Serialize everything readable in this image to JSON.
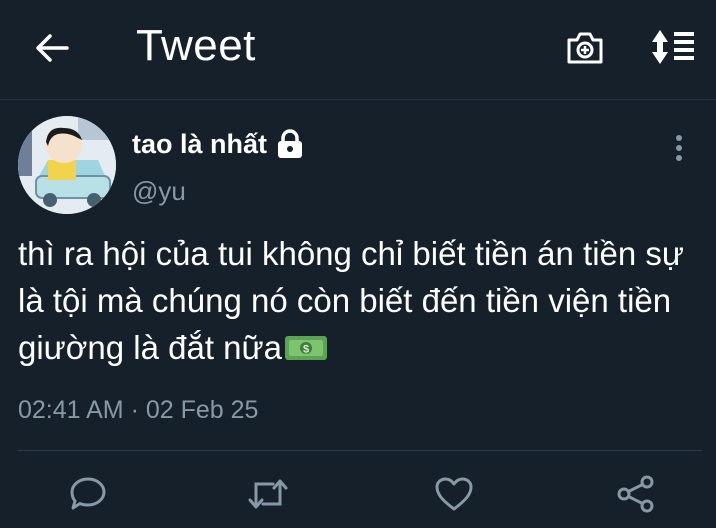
{
  "header": {
    "title": "Tweet",
    "icons": [
      "back-arrow-icon",
      "camera-icon",
      "sort-icon"
    ]
  },
  "tweet": {
    "display_name": "tao là nhất",
    "handle": "@yu",
    "protected": true,
    "text": "thì ra hội của tui không chỉ biết tiền án tiền sự là tội mà chúng nó còn biết đến tiền viện tiền giường là đắt nữa",
    "emoji": "money-banknote",
    "timestamp": "02:41 AM · 02 Feb 25"
  },
  "actions": [
    "reply-icon",
    "retweet-icon",
    "like-icon",
    "share-icon"
  ],
  "colors": {
    "background": "#15202b",
    "secondary_text": "#8899a6",
    "divider": "#2c3b49",
    "icon": "#8899a6"
  }
}
